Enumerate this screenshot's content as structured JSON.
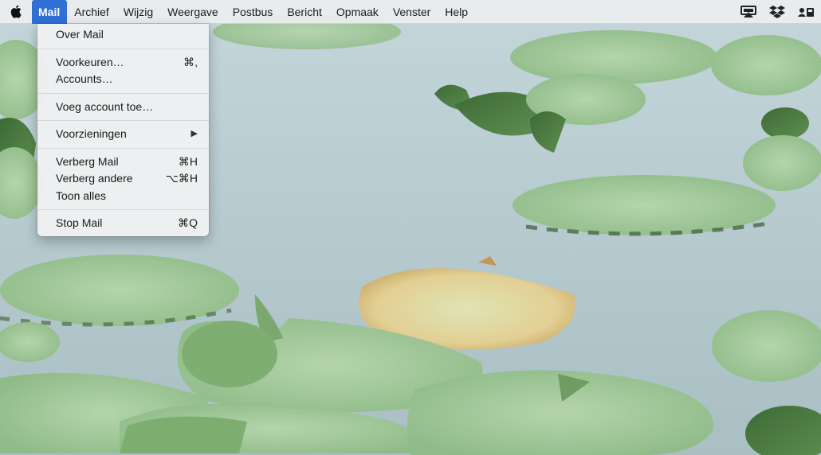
{
  "menubar": {
    "apple_icon": "apple-logo-icon",
    "items": [
      {
        "label": "Mail",
        "active": true
      },
      {
        "label": "Archief"
      },
      {
        "label": "Wijzig"
      },
      {
        "label": "Weergave"
      },
      {
        "label": "Postbus"
      },
      {
        "label": "Bericht"
      },
      {
        "label": "Opmaak"
      },
      {
        "label": "Venster"
      },
      {
        "label": "Help"
      }
    ],
    "status_icons": [
      "screen-mirroring-icon",
      "dropbox-icon",
      "user-switch-icon"
    ],
    "accent_color": "#2f6fd6"
  },
  "mail_menu": {
    "about": "Over Mail",
    "preferences": {
      "label": "Voorkeuren…",
      "shortcut": "⌘,"
    },
    "accounts": "Accounts…",
    "add_account": "Voeg account toe…",
    "services": {
      "label": "Voorzieningen",
      "arrow": "▶"
    },
    "hide_mail": {
      "label": "Verberg Mail",
      "shortcut": "⌘H"
    },
    "hide_others": {
      "label": "Verberg andere",
      "shortcut": "⌥⌘H"
    },
    "show_all": "Toon alles",
    "quit": {
      "label": "Stop Mail",
      "shortcut": "⌘Q"
    }
  },
  "desktop": {
    "wallpaper": "lily-pads-on-water"
  }
}
